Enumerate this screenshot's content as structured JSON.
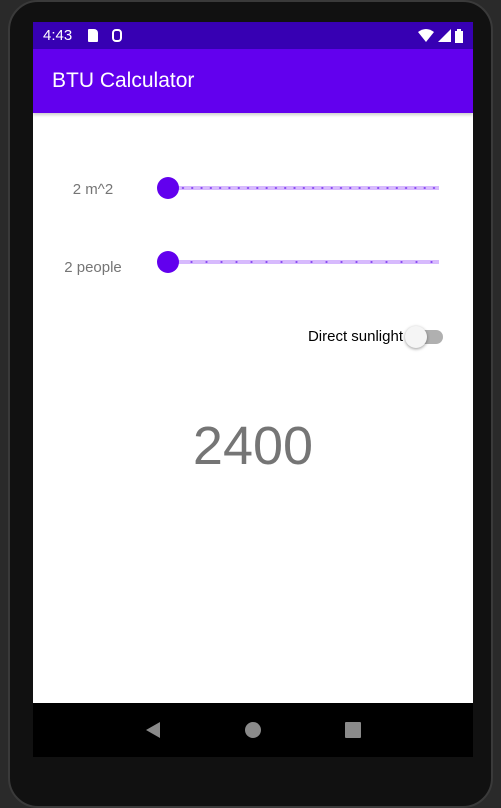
{
  "status": {
    "time": "4:43"
  },
  "app": {
    "title": "BTU Calculator"
  },
  "area": {
    "label": "2 m^2",
    "value_fraction": 0
  },
  "people": {
    "label": "2 people",
    "value_fraction": 0
  },
  "sunlight": {
    "label": "Direct sunlight",
    "checked": false
  },
  "result": "2400",
  "colors": {
    "primary": "#6200ee",
    "primary_dark": "#3700b3"
  }
}
